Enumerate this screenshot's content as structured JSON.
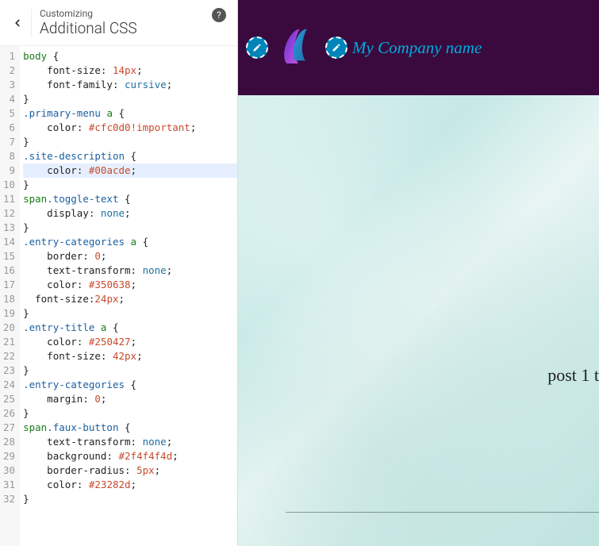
{
  "header": {
    "small": "Customizing",
    "big": "Additional CSS",
    "help_tooltip": "?"
  },
  "code": {
    "active_line": 9,
    "lines": [
      [
        {
          "t": "tag",
          "v": "body"
        },
        {
          "t": "punc",
          "v": " {"
        }
      ],
      [
        {
          "t": "sp",
          "v": "    "
        },
        {
          "t": "prop",
          "v": "font-size"
        },
        {
          "t": "punc",
          "v": ": "
        },
        {
          "t": "num",
          "v": "14"
        },
        {
          "t": "unit",
          "v": "px"
        },
        {
          "t": "punc",
          "v": ";"
        }
      ],
      [
        {
          "t": "sp",
          "v": "    "
        },
        {
          "t": "prop",
          "v": "font-family"
        },
        {
          "t": "punc",
          "v": ": "
        },
        {
          "t": "kw",
          "v": "cursive"
        },
        {
          "t": "punc",
          "v": ";"
        }
      ],
      [
        {
          "t": "punc",
          "v": "}"
        }
      ],
      [
        {
          "t": "class",
          "v": ".primary-menu"
        },
        {
          "t": "sp",
          "v": " "
        },
        {
          "t": "tag",
          "v": "a"
        },
        {
          "t": "punc",
          "v": " {"
        }
      ],
      [
        {
          "t": "sp",
          "v": "    "
        },
        {
          "t": "prop",
          "v": "color"
        },
        {
          "t": "punc",
          "v": ": "
        },
        {
          "t": "hex",
          "v": "#cfc0d0"
        },
        {
          "t": "bang",
          "v": "!important"
        },
        {
          "t": "punc",
          "v": ";"
        }
      ],
      [
        {
          "t": "punc",
          "v": "}"
        }
      ],
      [
        {
          "t": "class",
          "v": ".site-description"
        },
        {
          "t": "punc",
          "v": " {"
        }
      ],
      [
        {
          "t": "sp",
          "v": "    "
        },
        {
          "t": "prop",
          "v": "color"
        },
        {
          "t": "punc",
          "v": ": "
        },
        {
          "t": "hex",
          "v": "#00acde"
        },
        {
          "t": "punc",
          "v": ";"
        }
      ],
      [
        {
          "t": "punc",
          "v": "}"
        }
      ],
      [
        {
          "t": "tag",
          "v": "span"
        },
        {
          "t": "class",
          "v": ".toggle-text"
        },
        {
          "t": "punc",
          "v": " {"
        }
      ],
      [
        {
          "t": "sp",
          "v": "    "
        },
        {
          "t": "prop",
          "v": "display"
        },
        {
          "t": "punc",
          "v": ": "
        },
        {
          "t": "kw",
          "v": "none"
        },
        {
          "t": "punc",
          "v": ";"
        }
      ],
      [
        {
          "t": "punc",
          "v": "}"
        }
      ],
      [
        {
          "t": "class",
          "v": ".entry-categories"
        },
        {
          "t": "sp",
          "v": " "
        },
        {
          "t": "tag",
          "v": "a"
        },
        {
          "t": "punc",
          "v": " {"
        }
      ],
      [
        {
          "t": "sp",
          "v": "    "
        },
        {
          "t": "prop",
          "v": "border"
        },
        {
          "t": "punc",
          "v": ": "
        },
        {
          "t": "num",
          "v": "0"
        },
        {
          "t": "punc",
          "v": ";"
        }
      ],
      [
        {
          "t": "sp",
          "v": "    "
        },
        {
          "t": "prop",
          "v": "text-transform"
        },
        {
          "t": "punc",
          "v": ": "
        },
        {
          "t": "kw",
          "v": "none"
        },
        {
          "t": "punc",
          "v": ";"
        }
      ],
      [
        {
          "t": "sp",
          "v": "    "
        },
        {
          "t": "prop",
          "v": "color"
        },
        {
          "t": "punc",
          "v": ": "
        },
        {
          "t": "hex",
          "v": "#350638"
        },
        {
          "t": "punc",
          "v": ";"
        }
      ],
      [
        {
          "t": "sp",
          "v": "  "
        },
        {
          "t": "prop",
          "v": "font-size"
        },
        {
          "t": "punc",
          "v": ":"
        },
        {
          "t": "num",
          "v": "24"
        },
        {
          "t": "unit",
          "v": "px"
        },
        {
          "t": "punc",
          "v": ";"
        }
      ],
      [
        {
          "t": "punc",
          "v": "}"
        }
      ],
      [
        {
          "t": "class",
          "v": ".entry-title"
        },
        {
          "t": "sp",
          "v": " "
        },
        {
          "t": "tag",
          "v": "a"
        },
        {
          "t": "punc",
          "v": " {"
        }
      ],
      [
        {
          "t": "sp",
          "v": "    "
        },
        {
          "t": "prop",
          "v": "color"
        },
        {
          "t": "punc",
          "v": ": "
        },
        {
          "t": "hex",
          "v": "#250427"
        },
        {
          "t": "punc",
          "v": ";"
        }
      ],
      [
        {
          "t": "sp",
          "v": "    "
        },
        {
          "t": "prop",
          "v": "font-size"
        },
        {
          "t": "punc",
          "v": ": "
        },
        {
          "t": "num",
          "v": "42"
        },
        {
          "t": "unit",
          "v": "px"
        },
        {
          "t": "punc",
          "v": ";"
        }
      ],
      [
        {
          "t": "punc",
          "v": "}"
        }
      ],
      [
        {
          "t": "class",
          "v": ".entry-categories"
        },
        {
          "t": "punc",
          "v": " {"
        }
      ],
      [
        {
          "t": "sp",
          "v": "    "
        },
        {
          "t": "prop",
          "v": "margin"
        },
        {
          "t": "punc",
          "v": ": "
        },
        {
          "t": "num",
          "v": "0"
        },
        {
          "t": "punc",
          "v": ";"
        }
      ],
      [
        {
          "t": "punc",
          "v": "}"
        }
      ],
      [
        {
          "t": "tag",
          "v": "span"
        },
        {
          "t": "class",
          "v": ".faux-button"
        },
        {
          "t": "punc",
          "v": " {"
        }
      ],
      [
        {
          "t": "sp",
          "v": "    "
        },
        {
          "t": "prop",
          "v": "text-transform"
        },
        {
          "t": "punc",
          "v": ": "
        },
        {
          "t": "kw",
          "v": "none"
        },
        {
          "t": "punc",
          "v": ";"
        }
      ],
      [
        {
          "t": "sp",
          "v": "    "
        },
        {
          "t": "prop",
          "v": "background"
        },
        {
          "t": "punc",
          "v": ": "
        },
        {
          "t": "hex",
          "v": "#2f4f4f4d"
        },
        {
          "t": "punc",
          "v": ";"
        }
      ],
      [
        {
          "t": "sp",
          "v": "    "
        },
        {
          "t": "prop",
          "v": "border-radius"
        },
        {
          "t": "punc",
          "v": ": "
        },
        {
          "t": "num",
          "v": "5"
        },
        {
          "t": "unit",
          "v": "px"
        },
        {
          "t": "punc",
          "v": ";"
        }
      ],
      [
        {
          "t": "sp",
          "v": "    "
        },
        {
          "t": "prop",
          "v": "color"
        },
        {
          "t": "punc",
          "v": ": "
        },
        {
          "t": "hex",
          "v": "#23282d"
        },
        {
          "t": "punc",
          "v": ";"
        }
      ],
      [
        {
          "t": "punc",
          "v": "}"
        }
      ]
    ]
  },
  "preview": {
    "company_name": "My Company name",
    "post_title": "post 1 t"
  }
}
